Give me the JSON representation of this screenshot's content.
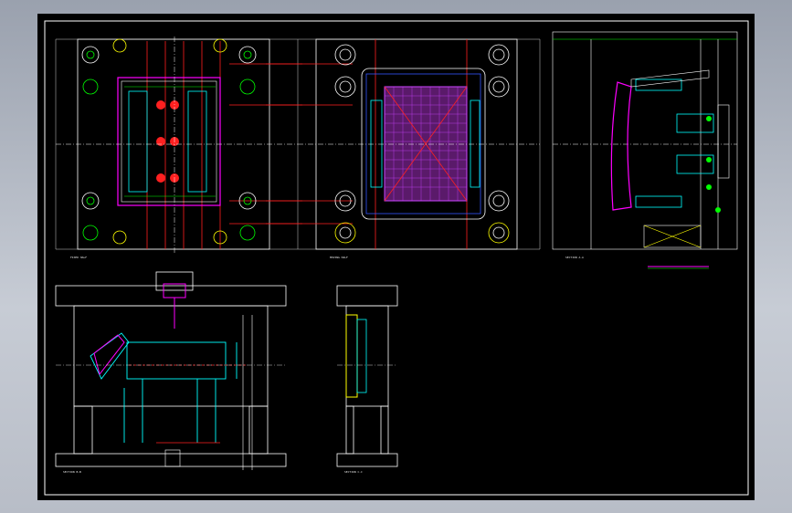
{
  "drawing": {
    "views": [
      {
        "id": "view-fixed-half",
        "label": "FIXED  HALF"
      },
      {
        "id": "view-moving-half",
        "label": "MOVING  HALF"
      },
      {
        "id": "view-section-a",
        "label": "SECTION  A-A"
      },
      {
        "id": "view-section-b",
        "label": "SECTION  B-B"
      },
      {
        "id": "view-section-c",
        "label": "SECTION  C-C"
      }
    ],
    "colors": {
      "background": "#000000",
      "frame": "#ffffff",
      "plates": "#ffffff",
      "cooling": "#ff2020",
      "centerlines": "#ffffff",
      "cavity": "#ff00ff",
      "inserts": "#00ffff",
      "ejector_grid": "#cc44ff",
      "dimensions": "#00ff00",
      "annotations": "#ffff00",
      "outline_blue": "#3355ff"
    }
  }
}
